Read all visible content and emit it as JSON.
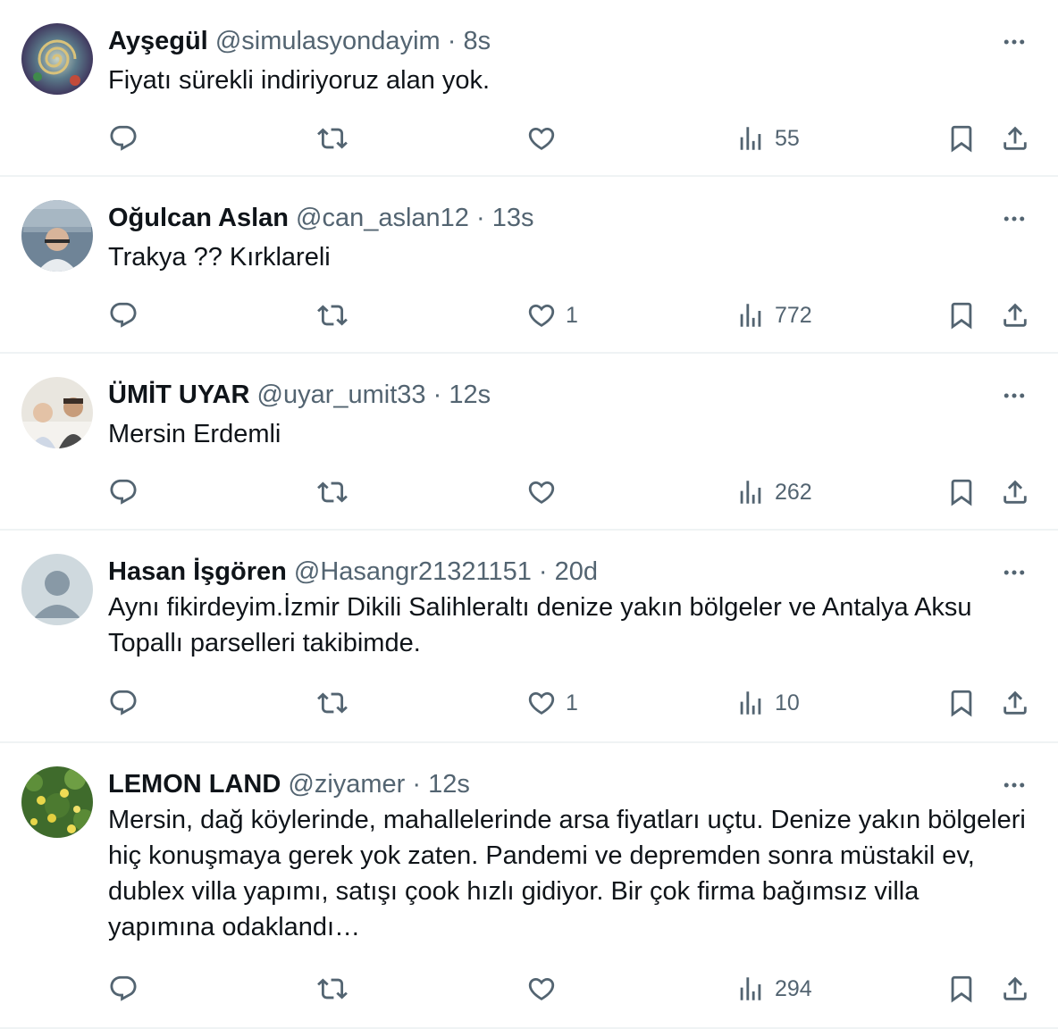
{
  "tweets": [
    {
      "name": "Ayşegül",
      "handle": "@simulasyondayim",
      "time": "8s",
      "text": "Fiyatı sürekli indiriyoruz alan yok.",
      "replies": "",
      "retweets": "",
      "likes": "",
      "views": "55"
    },
    {
      "name": "Oğulcan Aslan",
      "handle": "@can_aslan12",
      "time": "13s",
      "text": "Trakya ?? Kırklareli",
      "replies": "",
      "retweets": "",
      "likes": "1",
      "views": "772"
    },
    {
      "name": "ÜMİT UYAR",
      "handle": "@uyar_umit33",
      "time": "12s",
      "text": "Mersin Erdemli",
      "replies": "",
      "retweets": "",
      "likes": "",
      "views": "262"
    },
    {
      "name": "Hasan İşgören",
      "handle": "@Hasangr21321151",
      "time": "20d",
      "text": "Aynı fikirdeyim.İzmir Dikili Salihleraltı denize yakın bölgeler ve Antalya Aksu Topallı parselleri takibimde.",
      "replies": "",
      "retweets": "",
      "likes": "1",
      "views": "10"
    },
    {
      "name": "LEMON LAND",
      "handle": "@ziyamer",
      "time": "12s",
      "text": "Mersin, dağ köylerinde, mahallelerinde arsa fiyatları uçtu. Denize yakın bölgeleri hiç konuşmaya gerek yok zaten. Pandemi ve depremden sonra müstakil ev, dublex villa yapımı, satışı çook hızlı gidiyor. Bir çok firma bağımsız villa yapımına odaklandı…",
      "replies": "",
      "retweets": "",
      "likes": "",
      "views": "294"
    }
  ],
  "separator": "·",
  "colors": {
    "text": "#0f1419",
    "secondary": "#536471",
    "divider": "#eff3f4"
  },
  "icons": {
    "reply": "reply-icon",
    "retweet": "retweet-icon",
    "like": "heart-icon",
    "views": "views-icon",
    "bookmark": "bookmark-icon",
    "share": "share-icon",
    "more": "more-icon"
  }
}
